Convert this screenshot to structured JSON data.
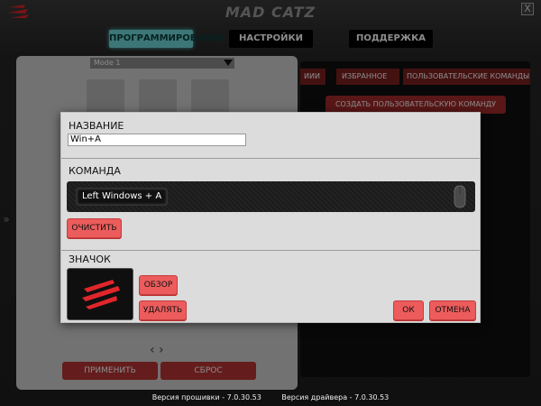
{
  "app": {
    "brand": "MAD CATZ",
    "close_glyph": "X",
    "logo_icon": "madcatz-claw-icon"
  },
  "nav": {
    "tabs": [
      {
        "label": "ПРОГРАММИРОВАНИЕ",
        "active": true
      },
      {
        "label": "НАСТРОЙКИ",
        "active": false
      },
      {
        "label": "ПОДДЕРЖКА",
        "active": false
      }
    ]
  },
  "left_panel": {
    "mode_value": "Mode 1",
    "apply_label": "ПРИМЕНИТЬ",
    "reset_label": "СБРОС"
  },
  "right_panel": {
    "tabs": [
      "ИИИ",
      "ИЗБРАННОЕ",
      "ПОЛЬЗОВАТЕЛЬСКИЕ КОМАНДЫ"
    ],
    "create_label": "СОЗДАТЬ ПОЛЬЗОВАТЕЛЬСКУЮ КОМАНДУ"
  },
  "dialog": {
    "name_label": "НАЗВАНИЕ",
    "name_value": "Win+A",
    "command_label": "КОМАНДА",
    "command_value": "Left Windows + A",
    "clear_label": "ОЧИСТИТЬ",
    "icon_label": "ЗНАЧОК",
    "browse_label": "ОБЗОР",
    "delete_label": "УДАЛЯТЬ",
    "ok_label": "ОК",
    "cancel_label": "ОТМЕНА"
  },
  "footer": {
    "firmware": "Версия прошивки - 7.0.30.53",
    "driver": "Версия драйвера - 7.0.30.53"
  },
  "colors": {
    "accent_cyan": "#6fd7d9",
    "button_red": "#ec5c5c",
    "dialog_bg": "#dcdcdc"
  }
}
